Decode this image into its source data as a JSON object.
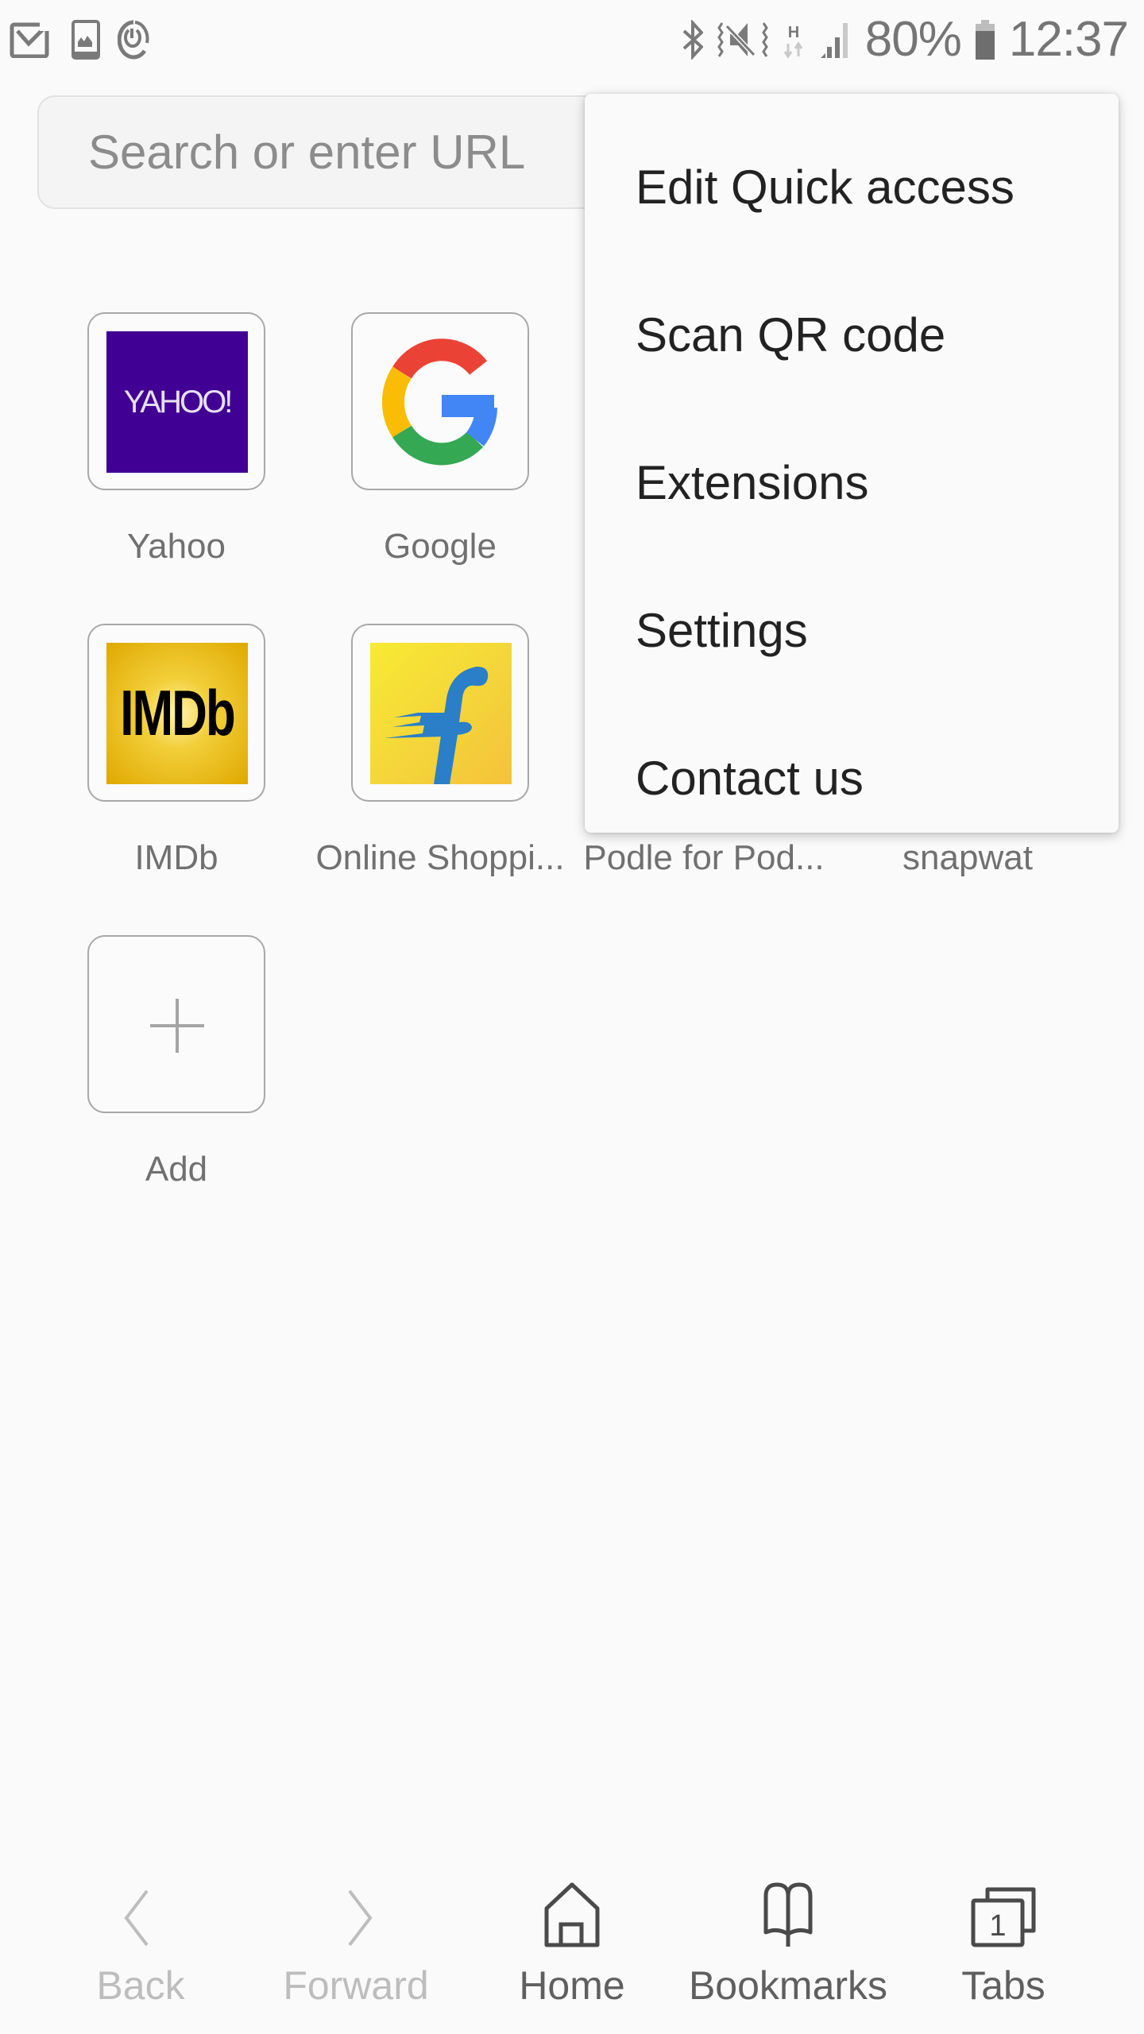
{
  "status_bar": {
    "left_icons": [
      "email-icon",
      "gallery-icon",
      "sync-icon"
    ],
    "right_icons": [
      "bluetooth-icon",
      "vibrate-mute-icon",
      "hspa-data-icon",
      "signal-icon"
    ],
    "network_type": "H",
    "battery_percent": "80%",
    "battery_level": 0.8,
    "time": "12:37"
  },
  "search": {
    "placeholder": "Search or enter URL",
    "value": ""
  },
  "quick_access": [
    {
      "label": "Yahoo",
      "icon": "yahoo-logo",
      "logo_text": "YAHOO!",
      "color": "#410093"
    },
    {
      "label": "Google",
      "icon": "google-logo",
      "colors": [
        "#ea4335",
        "#fbbc05",
        "#34a853",
        "#4285f4"
      ]
    },
    {
      "label": "IMDb",
      "icon": "imdb-logo",
      "logo_text": "IMDb",
      "color": "#e8b708"
    },
    {
      "label": "Online Shoppi...",
      "icon": "flipkart-logo",
      "color": "#f6df30",
      "accent": "#2a7fc8"
    },
    {
      "label": "Podle for Pod...",
      "icon": "podle-logo"
    },
    {
      "label": "snapwat",
      "icon": "snapwat-logo"
    },
    {
      "label": "Add",
      "icon": "plus-icon"
    }
  ],
  "menu": {
    "items": [
      "Edit Quick access",
      "Scan QR code",
      "Extensions",
      "Settings",
      "Contact us"
    ]
  },
  "bottom_nav": [
    {
      "label": "Back",
      "icon": "chevron-left-icon",
      "enabled": false
    },
    {
      "label": "Forward",
      "icon": "chevron-right-icon",
      "enabled": false
    },
    {
      "label": "Home",
      "icon": "home-icon",
      "enabled": true
    },
    {
      "label": "Bookmarks",
      "icon": "bookmarks-icon",
      "enabled": true
    },
    {
      "label": "Tabs",
      "icon": "tabs-icon",
      "enabled": true,
      "count": "1"
    }
  ]
}
